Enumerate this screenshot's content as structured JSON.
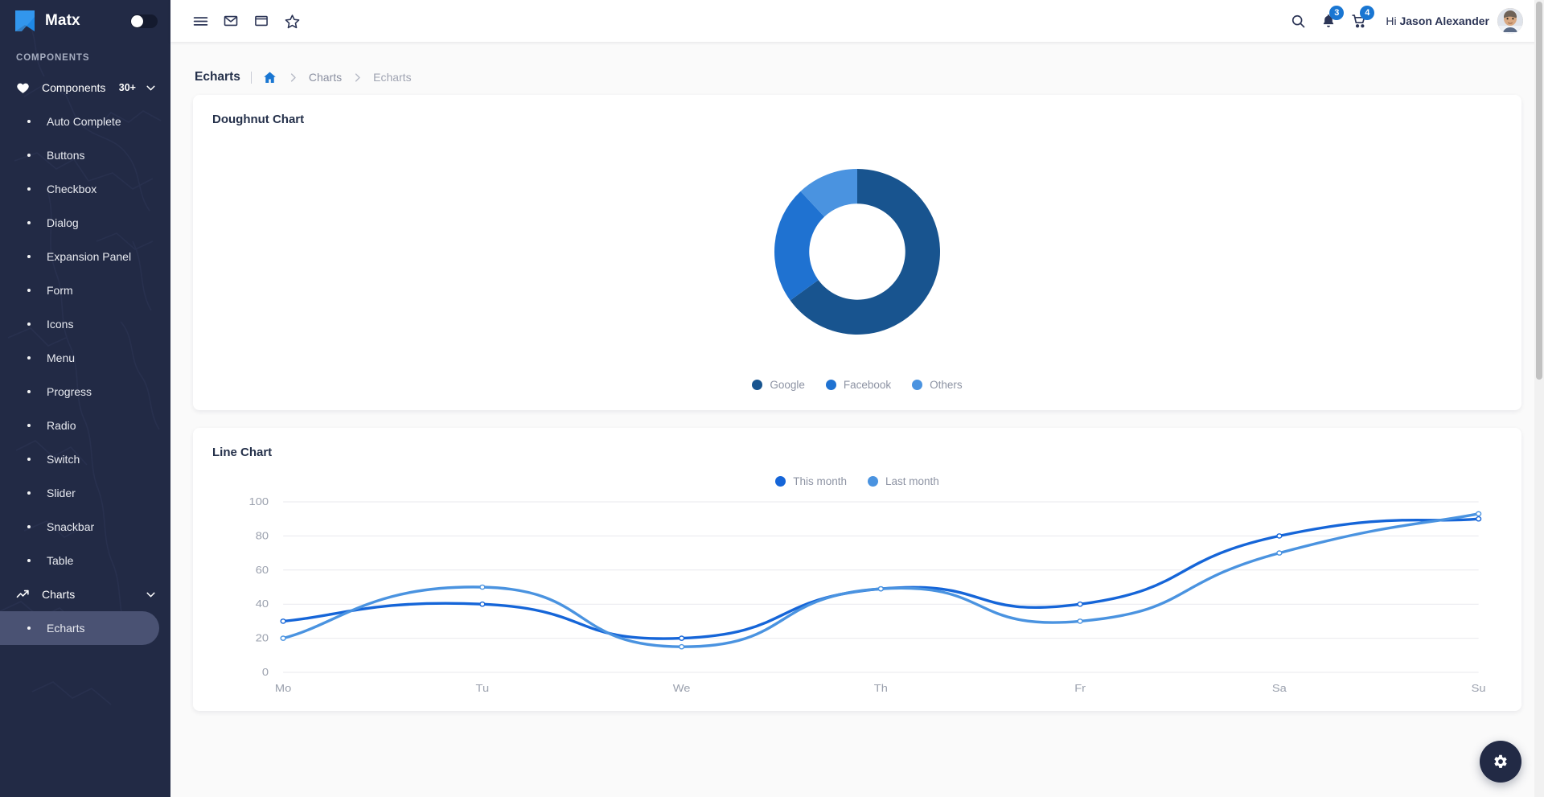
{
  "brand": {
    "name": "Matx",
    "logo_icon": "matx-logo-icon",
    "theme_toggle_icon": "theme-toggle-switch"
  },
  "sidebar": {
    "section_label": "COMPONENTS",
    "groups": [
      {
        "label": "Components",
        "badge": "30+",
        "icon": "heart-icon",
        "chevron": "chevron-down-icon"
      }
    ],
    "items": [
      {
        "label": "Auto Complete"
      },
      {
        "label": "Buttons"
      },
      {
        "label": "Checkbox"
      },
      {
        "label": "Dialog"
      },
      {
        "label": "Expansion Panel"
      },
      {
        "label": "Form"
      },
      {
        "label": "Icons"
      },
      {
        "label": "Menu"
      },
      {
        "label": "Progress"
      },
      {
        "label": "Radio"
      },
      {
        "label": "Switch"
      },
      {
        "label": "Slider"
      },
      {
        "label": "Snackbar"
      },
      {
        "label": "Table"
      }
    ],
    "charts_group": {
      "label": "Charts",
      "icon": "trending-up-icon",
      "chevron": "chevron-down-icon"
    },
    "charts_items": [
      {
        "label": "Echarts",
        "active": true
      }
    ],
    "active_bg": "#4a5273",
    "bg": "#222a45"
  },
  "topbar": {
    "menu_icon": "hamburger-menu-icon",
    "mail_icon": "envelope-icon",
    "window_icon": "window-icon",
    "star_icon": "star-outline-icon",
    "search_icon": "search-icon",
    "bell_icon": "bell-icon",
    "bell_badge": "3",
    "cart_icon": "shopping-cart-icon",
    "cart_badge": "4",
    "greeting_prefix": "Hi ",
    "user_name": "Jason Alexander",
    "avatar_icon": "user-avatar",
    "badge_color": "#1976d2"
  },
  "breadcrumb": {
    "title": "Echarts",
    "items": [
      {
        "label": "",
        "icon": "home-icon"
      },
      {
        "label": "Charts"
      },
      {
        "label": "Echarts"
      }
    ],
    "separator_icon": "chevron-right-icon"
  },
  "cards": {
    "doughnut": {
      "title": "Doughnut Chart"
    },
    "line": {
      "title": "Line Chart"
    }
  },
  "fab": {
    "icon": "gear-icon",
    "color": "#222a45"
  },
  "scrollbar": {
    "thumb_color": "#c1c1c1"
  },
  "chart_data": [
    {
      "type": "pie",
      "variant": "doughnut",
      "title": "Doughnut Chart",
      "categories": [
        "Google",
        "Facebook",
        "Others"
      ],
      "values": [
        65,
        23,
        12
      ],
      "colors": [
        "#18548f",
        "#1f72d1",
        "#4a93e0"
      ],
      "legend_position": "bottom",
      "start_angle": 90,
      "direction": "clockwise",
      "inner_radius_ratio": 0.58
    },
    {
      "type": "line",
      "title": "Line Chart",
      "x": [
        "Mo",
        "Tu",
        "We",
        "Th",
        "Fr",
        "Sa",
        "Su"
      ],
      "series": [
        {
          "name": "This month",
          "color": "#1565d8",
          "values": [
            30,
            40,
            20,
            49,
            40,
            80,
            90
          ]
        },
        {
          "name": "Last month",
          "color": "#4a93e0",
          "values": [
            20,
            50,
            15,
            49,
            30,
            70,
            93
          ]
        }
      ],
      "ylim": [
        0,
        100
      ],
      "yticks": [
        0,
        20,
        40,
        60,
        80,
        100
      ],
      "xlabel": "",
      "ylabel": "",
      "grid": true,
      "smooth": true,
      "legend_position": "top"
    }
  ]
}
